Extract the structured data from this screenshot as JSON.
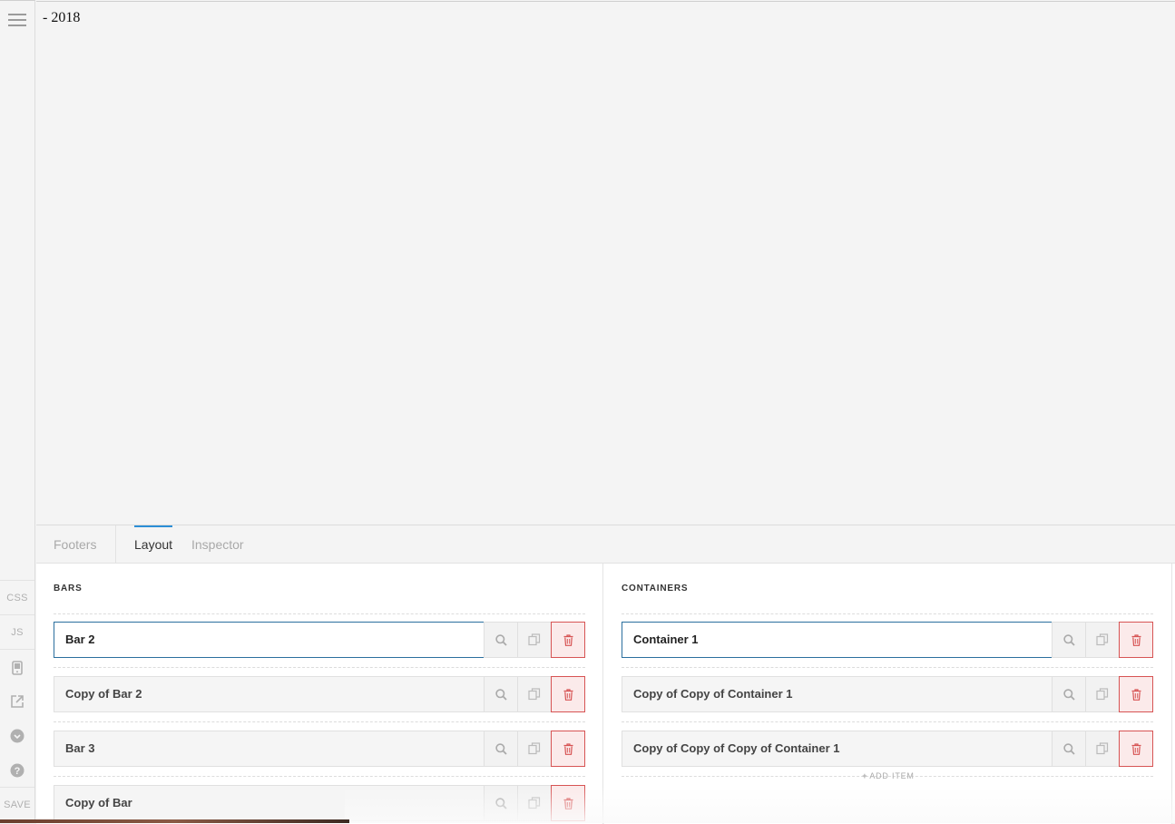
{
  "preview": {
    "text": "- 2018"
  },
  "rail": {
    "css_label": "CSS",
    "js_label": "JS",
    "save_label": "SAVE"
  },
  "tabs": [
    {
      "label": "Footers"
    },
    {
      "label": "Layout"
    },
    {
      "label": "Inspector"
    }
  ],
  "bars": {
    "title": "BARS",
    "items": [
      {
        "label": "Bar 2"
      },
      {
        "label": "Copy of Bar 2"
      },
      {
        "label": "Bar 3"
      },
      {
        "label": "Copy of Bar"
      }
    ]
  },
  "containers": {
    "title": "CONTAINERS",
    "items": [
      {
        "label": "Container 1"
      },
      {
        "label": "Copy of Copy of Container 1"
      },
      {
        "label": "Copy of Copy of Copy of Container 1"
      }
    ],
    "add_item_label": "ADD ITEM"
  },
  "colors": {
    "accent": "#2c8ed6",
    "delete": "#d75454",
    "selected_border": "#2b6f9e"
  }
}
